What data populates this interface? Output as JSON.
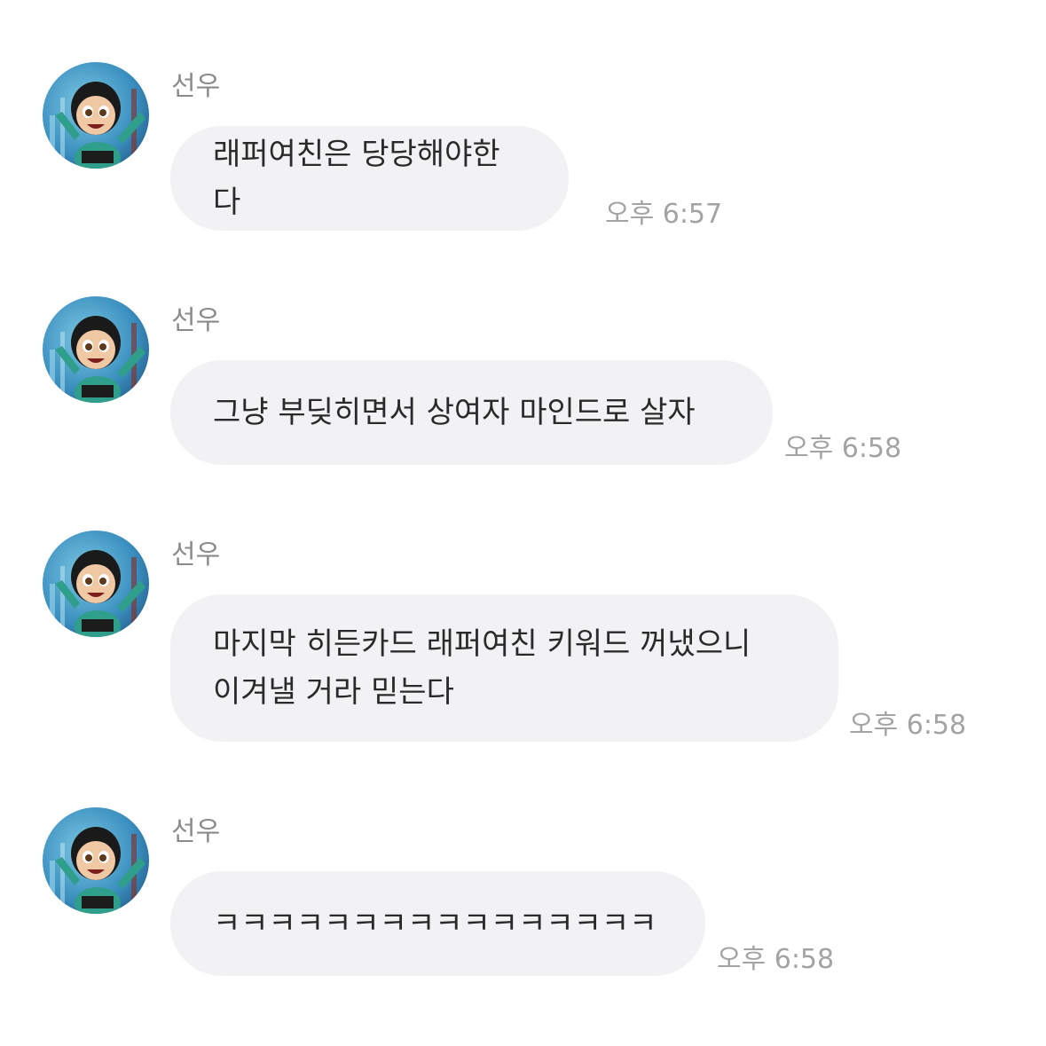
{
  "messages": [
    {
      "sender": "선우",
      "text": "래퍼여친은 당당해야한다",
      "time": "오후 6:57"
    },
    {
      "sender": "선우",
      "text": "그냥 부딪히면서 상여자 마인드로 살자",
      "time": "오후 6:58"
    },
    {
      "sender": "선우",
      "text": "마지막 히든카드 래퍼여친 키워드 꺼냈으니\n이겨낼 거라 믿는다",
      "time": "오후 6:58"
    },
    {
      "sender": "선우",
      "text": "ㅋㅋㅋㅋㅋㅋㅋㅋㅋㅋㅋㅋㅋㅋㅋㅋ",
      "time": "오후 6:58"
    }
  ],
  "colors": {
    "background": "#ffffff",
    "bubble": "#f2f2f4",
    "text": "#2a2a2a",
    "sender": "#8b8b8b",
    "time": "#a3a3a3"
  },
  "icons": {
    "avatar": "cartoon-girl-avatar"
  }
}
